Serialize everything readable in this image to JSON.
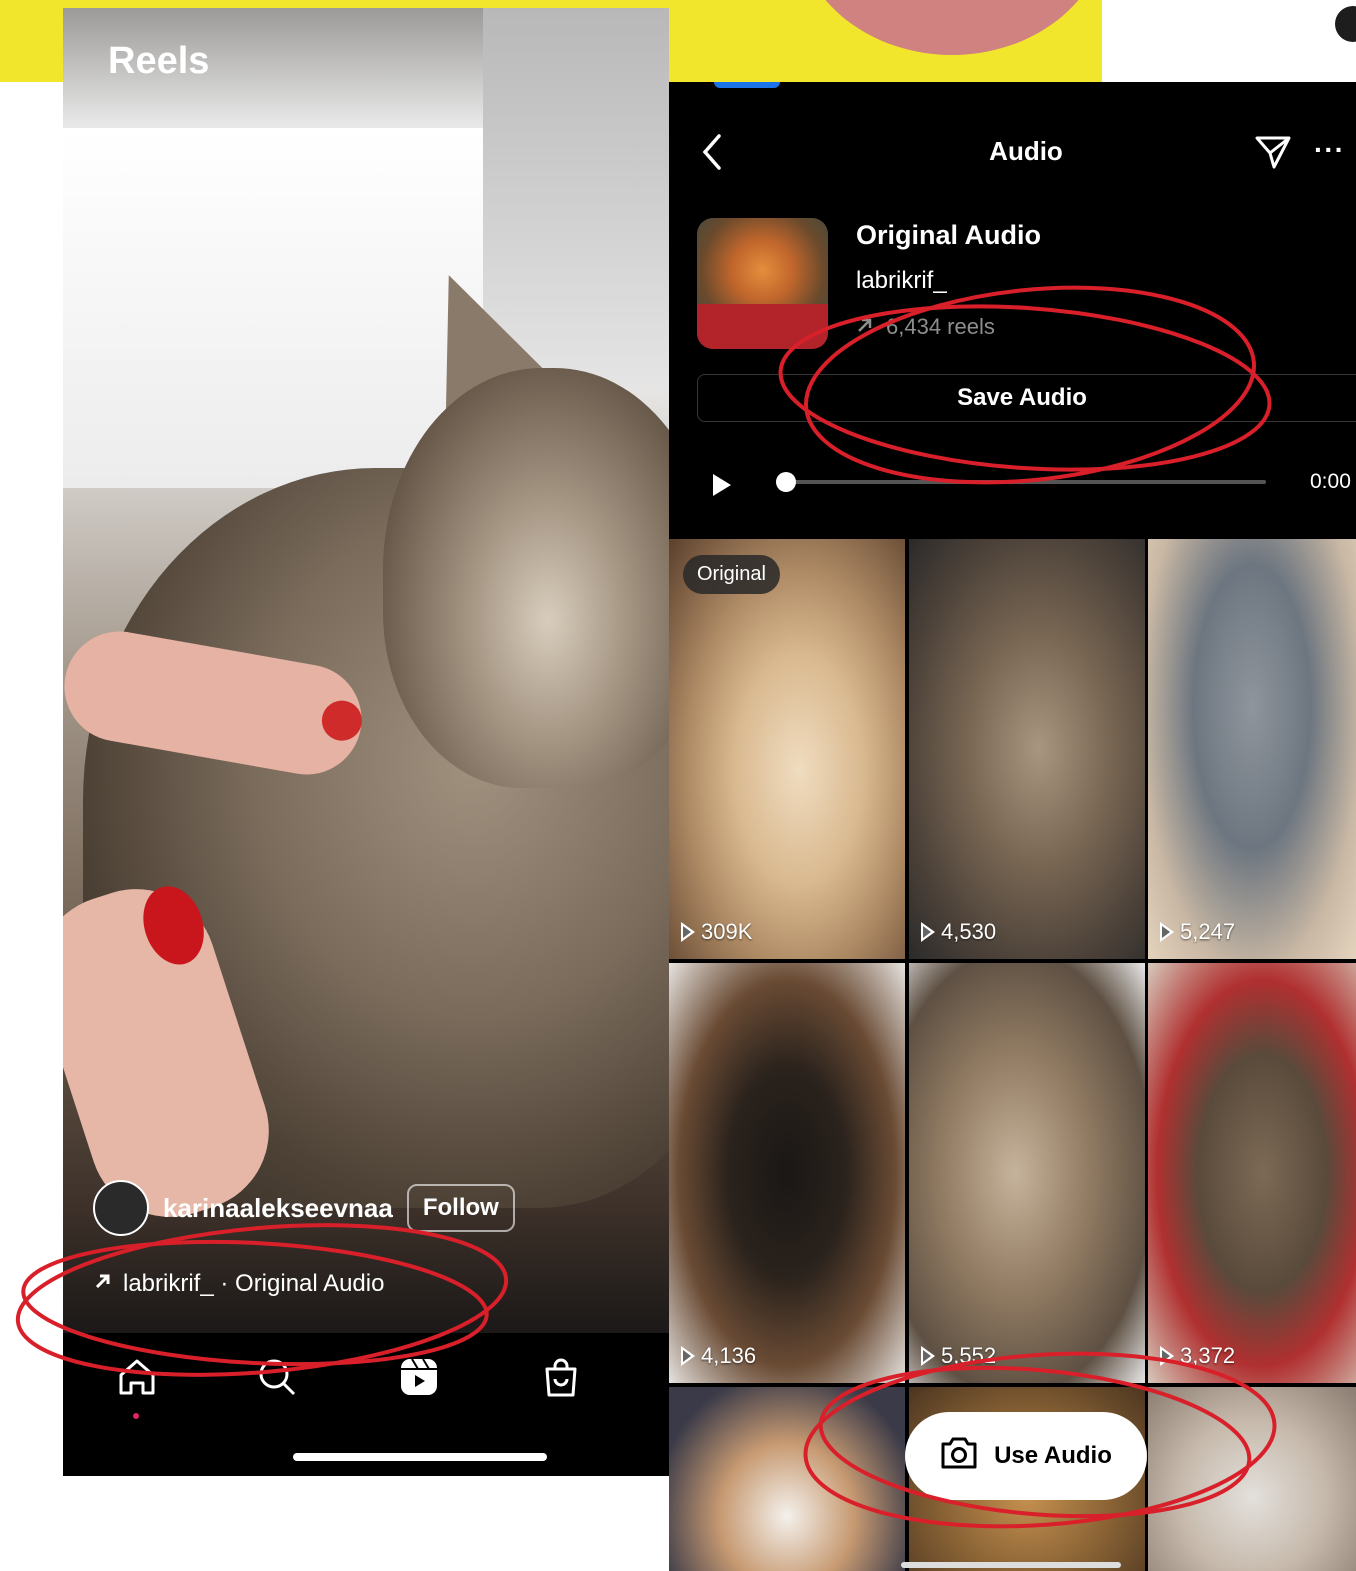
{
  "reels_screen": {
    "title": "Reels",
    "username": "karinaalekseevnaa",
    "follow_label": "Follow",
    "audio_link": "labrikrif_ · Original Audio",
    "nav": [
      "home-icon",
      "search-icon",
      "reels-icon",
      "shop-icon"
    ]
  },
  "audio_screen": {
    "header_title": "Audio",
    "more_label": "···",
    "audio_title": "Original Audio",
    "audio_user": "labrikrif_",
    "reels_count": "6,434 reels",
    "save_label": "Save Audio",
    "time": "0:00",
    "original_badge": "Original",
    "use_audio_label": "Use Audio",
    "tiles": [
      {
        "count": "309K"
      },
      {
        "count": "4,530"
      },
      {
        "count": "5,247"
      },
      {
        "count": "4,136"
      },
      {
        "count": "5,552"
      },
      {
        "count": "3,372"
      }
    ]
  },
  "colors": {
    "background_yellow": "#f2e62c",
    "annotation_red": "#d9202a",
    "notification_dot": "#e0245e"
  }
}
